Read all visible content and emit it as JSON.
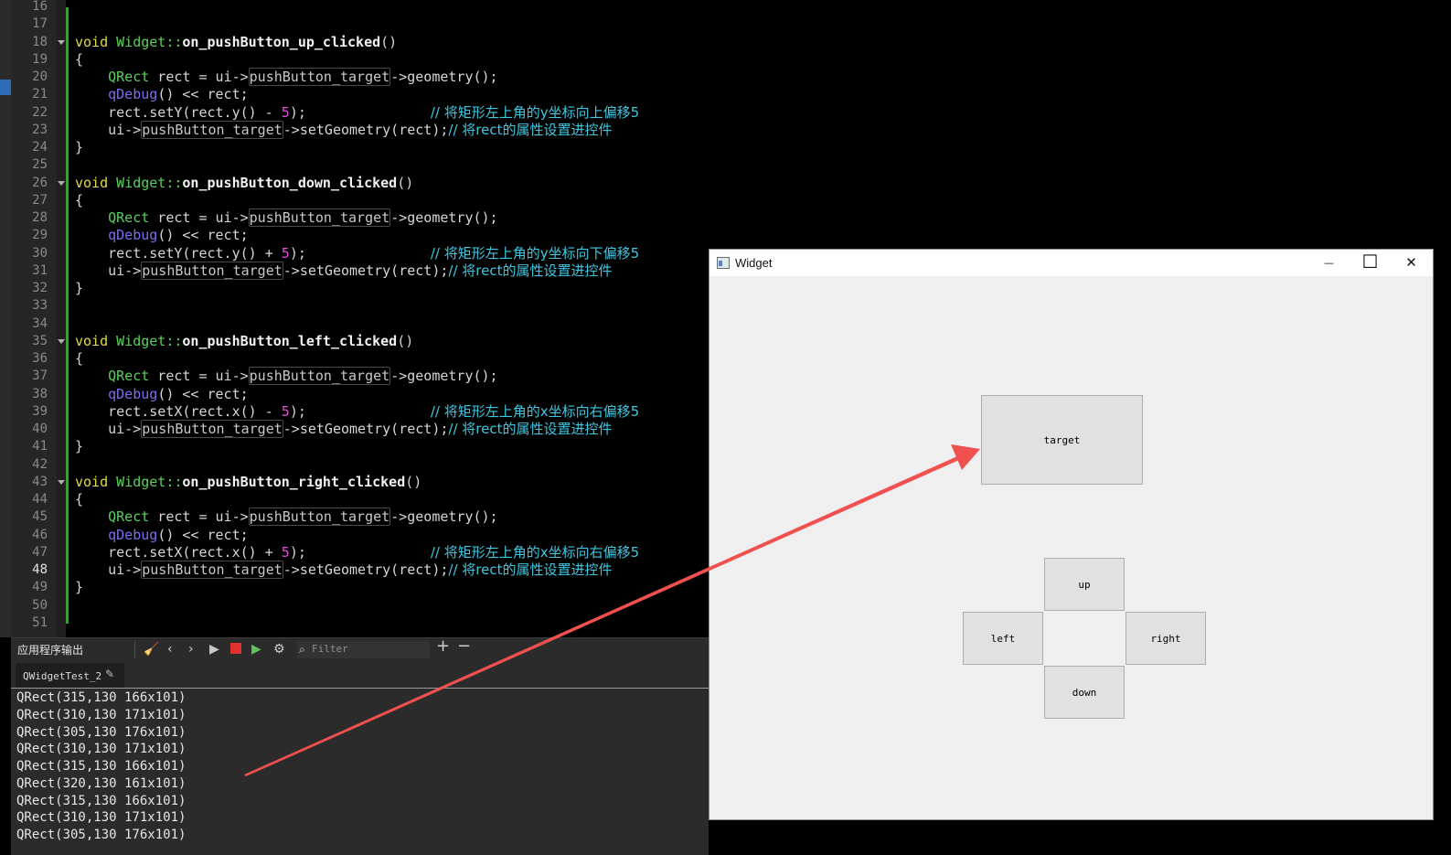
{
  "editor": {
    "line_numbers": [
      "16",
      "17",
      "18",
      "19",
      "20",
      "21",
      "22",
      "23",
      "24",
      "25",
      "26",
      "27",
      "28",
      "29",
      "30",
      "31",
      "32",
      "33",
      "34",
      "35",
      "36",
      "37",
      "38",
      "39",
      "40",
      "41",
      "42",
      "43",
      "44",
      "45",
      "46",
      "47",
      "48",
      "49",
      "50",
      "51"
    ],
    "current_line": "48",
    "methods": [
      {
        "name": "on_pushButton_up_clicked",
        "op": "setY",
        "getter": "y",
        "sign": "-",
        "comment1": "// 将矩形左上角的y坐标向上偏移5"
      },
      {
        "name": "on_pushButton_down_clicked",
        "op": "setY",
        "getter": "y",
        "sign": "+",
        "comment1": "// 将矩形左上角的y坐标向下偏移5"
      },
      {
        "name": "on_pushButton_left_clicked",
        "op": "setX",
        "getter": "x",
        "sign": "-",
        "comment1": "// 将矩形左上角的x坐标向右偏移5"
      },
      {
        "name": "on_pushButton_right_clicked",
        "op": "setX",
        "getter": "x",
        "sign": "+",
        "comment1": "// 将矩形左上角的x坐标向右偏移5"
      }
    ],
    "tokens": {
      "void": "void",
      "class_name": "Widget",
      "scope": "::",
      "parens": "()",
      "open_brace": "{",
      "close_brace": "}",
      "qrect": "QRect",
      "rect_assign": " rect = ui->",
      "target_member": "pushButton_target",
      "geometry_call": "->geometry();",
      "qdebug": "qDebug",
      "qdebug_rest": "() << rect;",
      "rect_dot": "rect.",
      "rect_open": "(rect.",
      "rect_mid": "() ",
      "five": "5",
      "close_call": ");",
      "ui_arrow": "ui->",
      "set_geometry": "->setGeometry(rect);",
      "comment2": "// 将rect的属性设置进控件"
    }
  },
  "output": {
    "title": "应用程序输出",
    "filter_placeholder": "Filter",
    "tab_label": "QWidgetTest_2",
    "log_lines": [
      "QRect(315,130 166x101)",
      "QRect(310,130 171x101)",
      "QRect(305,130 176x101)",
      "QRect(310,130 171x101)",
      "QRect(315,130 166x101)",
      "QRect(320,130 161x101)",
      "QRect(315,130 166x101)",
      "QRect(310,130 171x101)",
      "QRect(305,130 176x101)"
    ]
  },
  "widget_window": {
    "title": "Widget",
    "minimize": "—",
    "maximize": "☐",
    "close": "✕",
    "buttons": {
      "target": "target",
      "up": "up",
      "left": "left",
      "right": "right",
      "down": "down"
    }
  },
  "annotation": {
    "arrow_color": "#f05050"
  },
  "icons": [
    "clear-icon",
    "prev-icon",
    "next-icon",
    "run-icon",
    "stop-icon",
    "debug-run-icon",
    "settings-icon",
    "filter-search-icon",
    "plus-icon",
    "minus-icon",
    "window-app-icon",
    "pencil-icon"
  ]
}
